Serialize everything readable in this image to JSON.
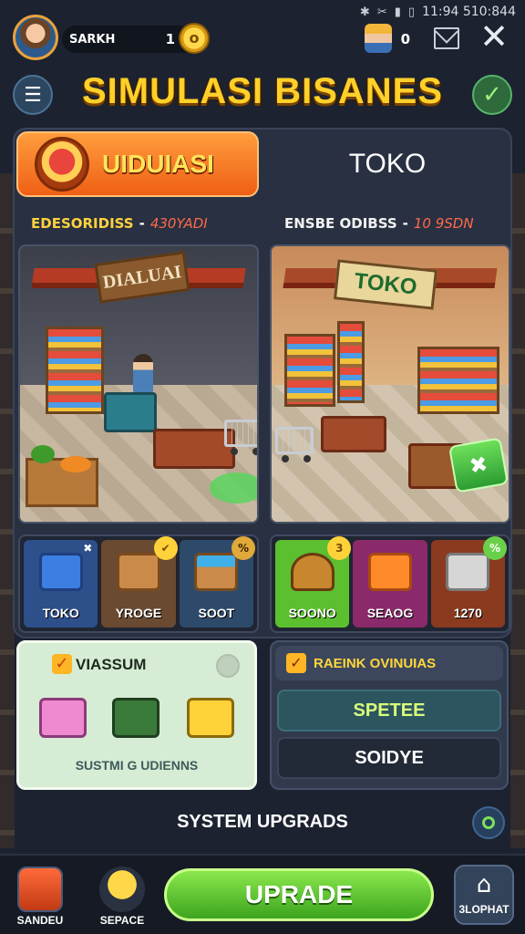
{
  "status_bar": {
    "time": "11:94 510:844",
    "icons": [
      "bluetooth-icon",
      "signal-off-icon",
      "sim-icon",
      "battery-icon"
    ]
  },
  "player": {
    "name": "SARKH",
    "coins": "1",
    "workers": "0"
  },
  "title": "SIMULASI BISANES",
  "tabs": {
    "active_label": "UIDUIASI",
    "inactive_label": "TOKO"
  },
  "columns": {
    "left": {
      "label": "EDESORIDISS",
      "value": "430YADI"
    },
    "right": {
      "label": "ENSBE ODIBSS",
      "value": "10 9SDN"
    }
  },
  "scenes": {
    "left_sign": "DIALUAI",
    "right_sign": "TOKO"
  },
  "items_left": [
    {
      "label": "TOKO",
      "corner": "✖"
    },
    {
      "label": "YROGE",
      "corner": "✔"
    },
    {
      "label": "SOOT",
      "corner": "%"
    }
  ],
  "items_right": [
    {
      "label": "SOONO",
      "corner": "3"
    },
    {
      "label": "SEAOG",
      "corner": ""
    },
    {
      "label": "1270",
      "corner": "%"
    }
  ],
  "upgrade_card": {
    "title": "VIASSUM",
    "subtitle": "SUSTMI G UDIENNS"
  },
  "reward_card": {
    "title": "RAEINK OVINUIAS",
    "speed_label": "SPETEE",
    "solve_label": "SOIDYE"
  },
  "system_label": "SYSTEM UPGRADS",
  "bottom_nav": {
    "left_label": "SANDEU",
    "mid_label": "SEPACE",
    "upgrade_label": "UPRADE",
    "right_label": "3LOPHAT"
  },
  "colors": {
    "title": "#ffd02a",
    "active_tab": "#ef5f16",
    "upgrade_button": "#3ca41e",
    "panel": "#293041"
  }
}
